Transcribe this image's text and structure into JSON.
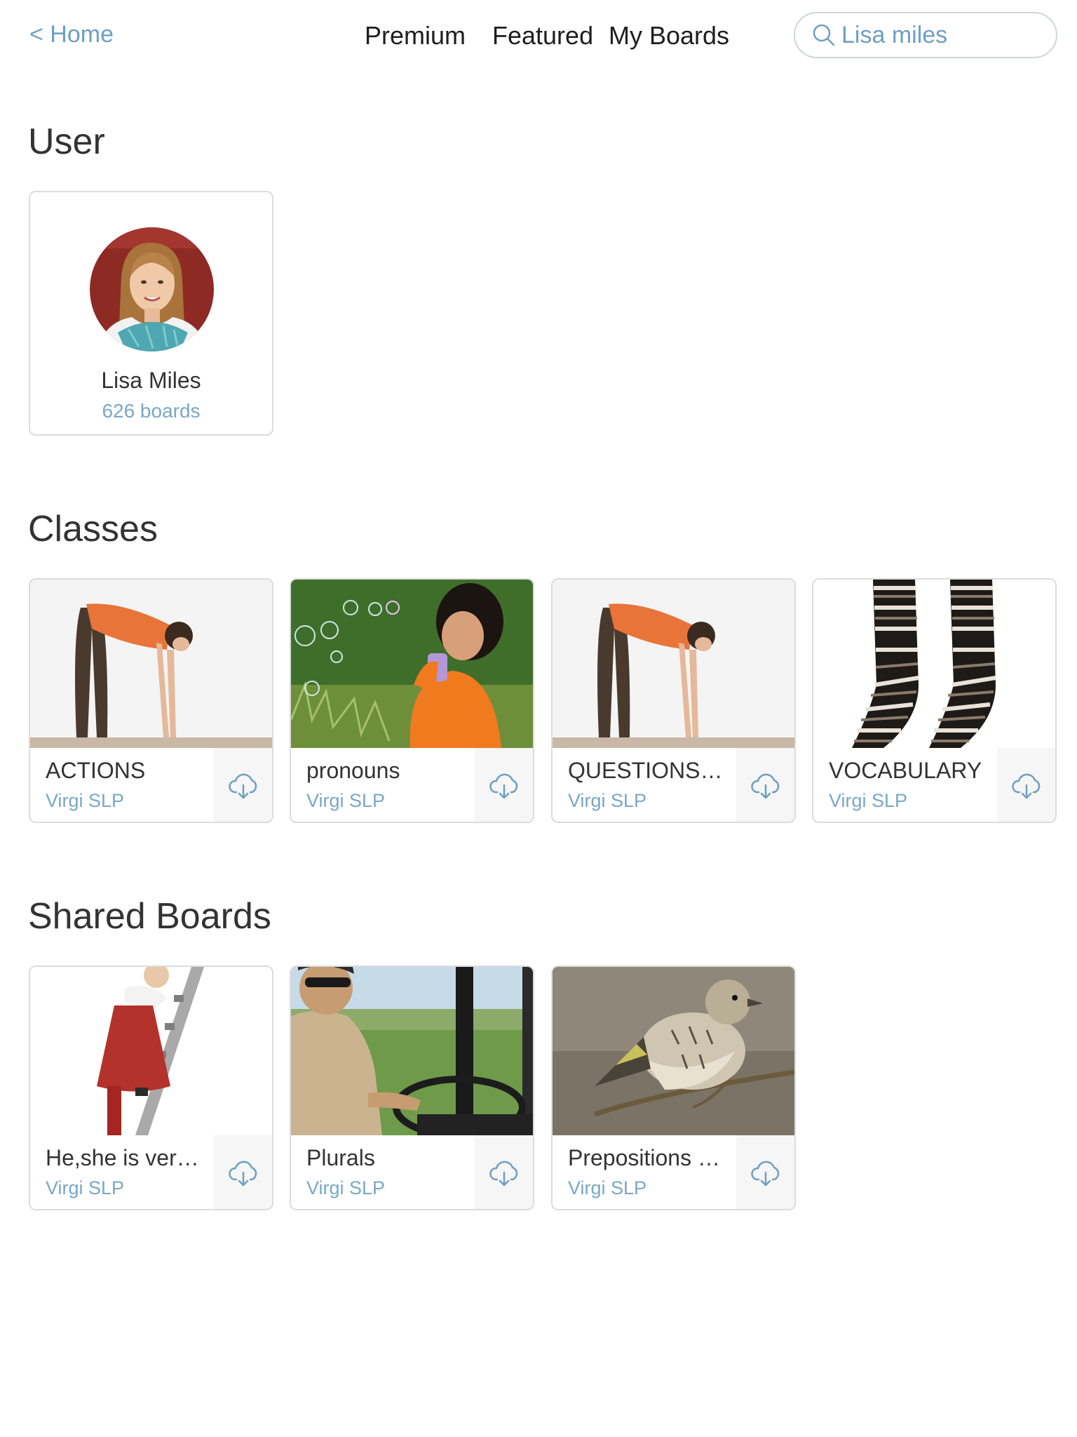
{
  "header": {
    "home_label": "< Home",
    "nav": {
      "premium": "Premium",
      "featured": "Featured",
      "my_boards": "My Boards"
    },
    "search": {
      "value": "Lisa miles",
      "icon": "search-icon"
    }
  },
  "sections": {
    "user": "User",
    "classes": "Classes",
    "shared": "Shared Boards"
  },
  "user": {
    "name": "Lisa Miles",
    "boards": "626 boards"
  },
  "classes": [
    {
      "title": "ACTIONS",
      "author": "Virgi SLP",
      "image": "woman-bending-over"
    },
    {
      "title": "pronouns",
      "author": "Virgi SLP",
      "image": "child-blowing-bubbles"
    },
    {
      "title": "QUESTIONS/I…",
      "author": "Virgi SLP",
      "image": "woman-bending-over"
    },
    {
      "title": "VOCABULARY",
      "author": "Virgi SLP",
      "image": "striped-socks"
    }
  ],
  "shared_boards": [
    {
      "title": "He,she is ver…",
      "author": "Virgi SLP",
      "image": "girl-climbing-ladder"
    },
    {
      "title": "Plurals",
      "author": "Virgi SLP",
      "image": "bus-driver"
    },
    {
      "title": "Prepositions (…",
      "author": "Virgi SLP",
      "image": "bird-on-branch"
    }
  ],
  "colors": {
    "accent": "#6e9fc1",
    "secondary_text": "#7aa7c6",
    "border": "#dcdcdc"
  }
}
